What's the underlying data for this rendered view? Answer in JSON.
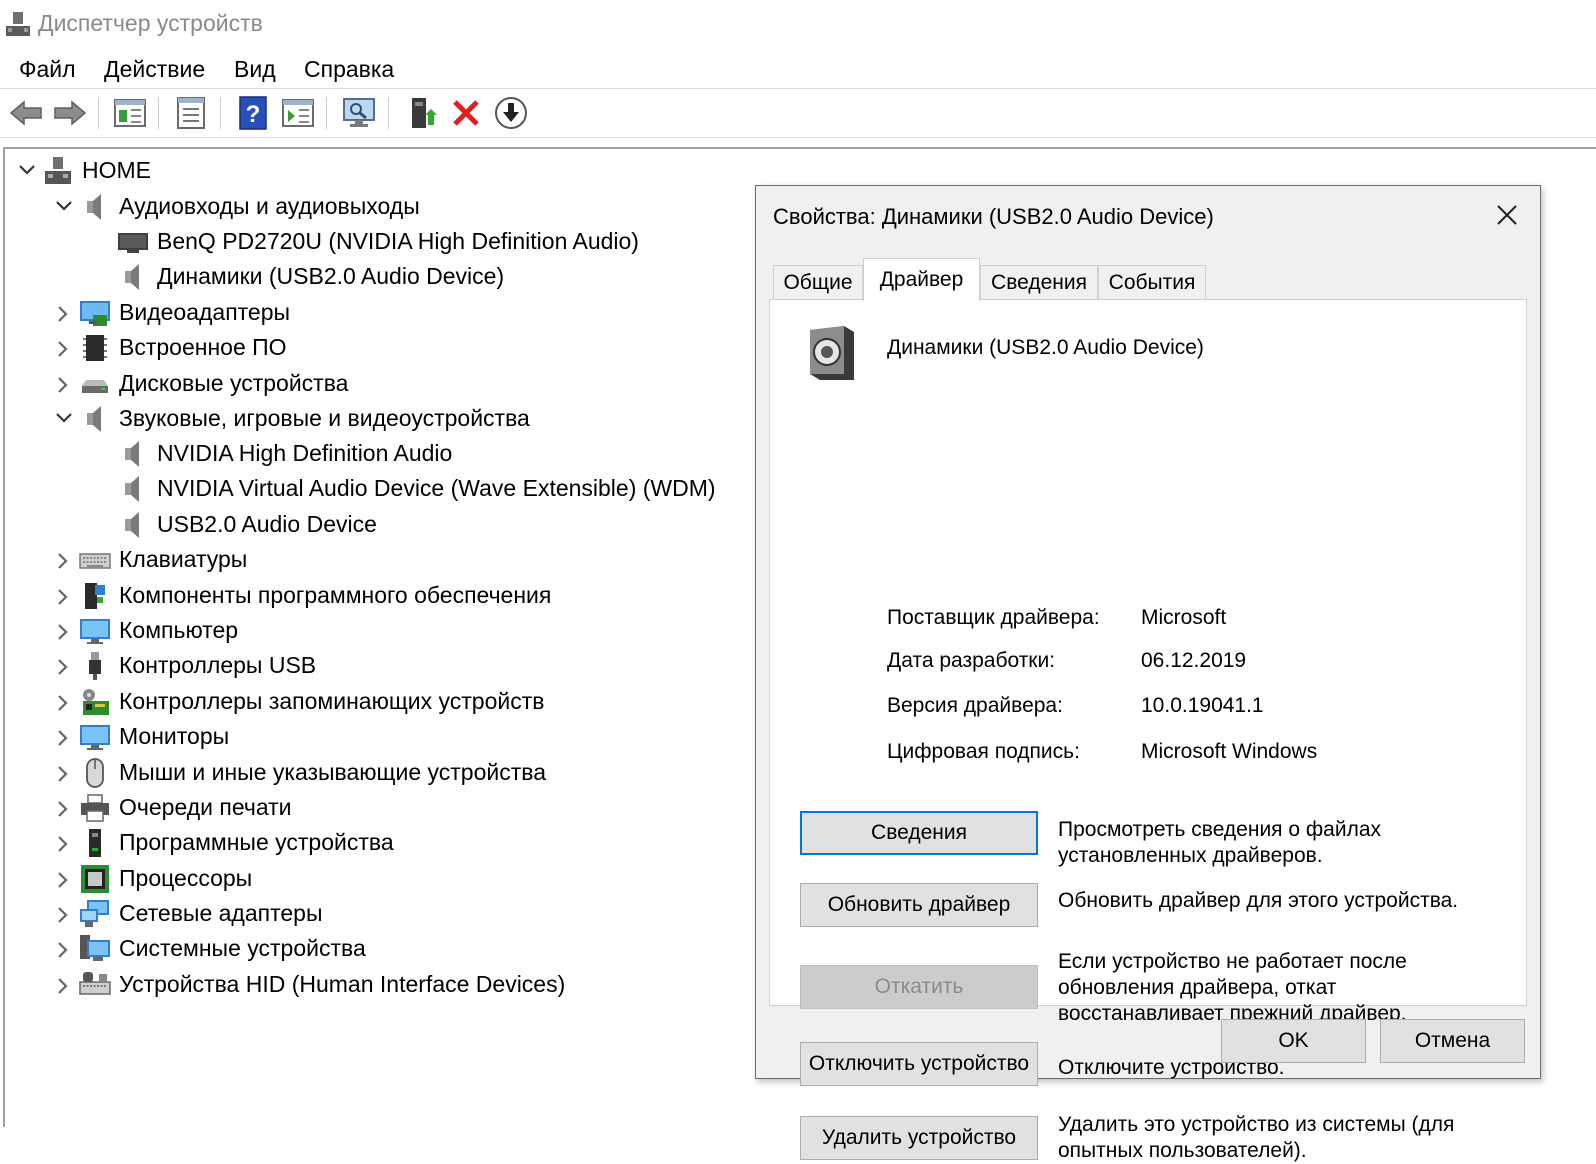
{
  "window": {
    "title": "Диспетчер устройств"
  },
  "menu": [
    "Файл",
    "Действие",
    "Вид",
    "Справка"
  ],
  "tree": {
    "root": "HOME",
    "items": [
      "Аудиовходы и аудиовыходы",
      "BenQ PD2720U (NVIDIA High Definition Audio)",
      "Динамики (USB2.0 Audio Device)",
      "Видеоадаптеры",
      "Встроенное ПО",
      "Дисковые устройства",
      "Звуковые, игровые и видеоустройства",
      "NVIDIA High Definition Audio",
      "NVIDIA Virtual Audio Device (Wave Extensible) (WDM)",
      "USB2.0 Audio Device",
      "Клавиатуры",
      "Компоненты программного обеспечения",
      "Компьютер",
      "Контроллеры USB",
      "Контроллеры запоминающих устройств",
      "Мониторы",
      "Мыши и иные указывающие устройства",
      "Очереди печати",
      "Программные устройства",
      "Процессоры",
      "Сетевые адаптеры",
      "Системные устройства",
      "Устройства HID (Human Interface Devices)"
    ]
  },
  "dialog": {
    "title": "Свойства: Динамики (USB2.0 Audio Device)",
    "tabs": [
      "Общие",
      "Драйвер",
      "Сведения",
      "События"
    ],
    "active_tab": "Драйвер",
    "device_name": "Динамики (USB2.0 Audio Device)",
    "props": [
      {
        "label": "Поставщик драйвера:",
        "value": "Microsoft"
      },
      {
        "label": "Дата разработки:",
        "value": "06.12.2019"
      },
      {
        "label": "Версия драйвера:",
        "value": "10.0.19041.1"
      },
      {
        "label": "Цифровая подпись:",
        "value": "Microsoft Windows"
      }
    ],
    "actions": [
      {
        "label": "Сведения",
        "desc": "Просмотреть сведения о файлах установленных драйверов."
      },
      {
        "label": "Обновить драйвер",
        "desc": "Обновить драйвер для этого устройства."
      },
      {
        "label": "Откатить",
        "desc": "Если устройство не работает после обновления драйвера, откат восстанавливает прежний драйвер."
      },
      {
        "label": "Отключить устройство",
        "desc": "Отключите устройство."
      },
      {
        "label": "Удалить устройство",
        "desc": "Удалить это устройство из системы (для опытных пользователей)."
      }
    ],
    "ok_label": "OK",
    "cancel_label": "Отмена"
  },
  "colors": {
    "focus": "#0078d7",
    "dialog_bg": "#f0f0f0",
    "button_bg": "#e1e1e1"
  }
}
